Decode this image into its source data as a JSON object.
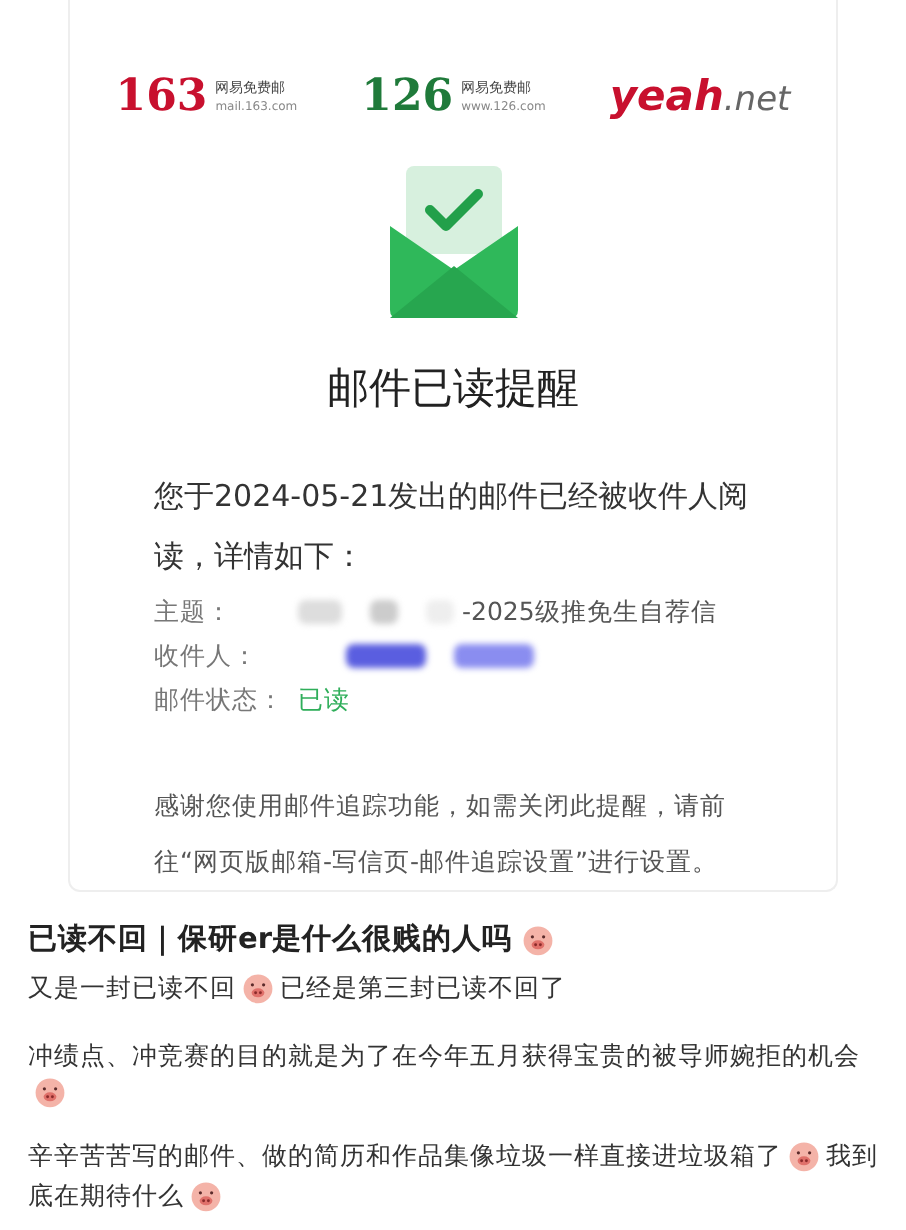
{
  "logos": [
    {
      "kind": "numeral",
      "color": "#c8102e",
      "mark": "163",
      "name": "网易免费邮",
      "url": "mail.163.com"
    },
    {
      "kind": "numeral",
      "color": "#1f7a3a",
      "mark": "126",
      "name": "网易免费邮",
      "url": "www.126.com"
    },
    {
      "kind": "wordmark",
      "color": "#c8102e",
      "mark": "yeah",
      "suffix": ".net"
    }
  ],
  "email": {
    "title": "邮件已读提醒",
    "intro": "您于2024-05-21发出的邮件已经被收件人阅读，详情如下：",
    "fields": [
      {
        "label": "主题：",
        "value": "-2025级推免生自荐信",
        "kind": "subject"
      },
      {
        "label": "收件人：",
        "kind": "recipient"
      },
      {
        "label": "邮件状态：",
        "value": "已读",
        "kind": "status"
      }
    ],
    "footer": "感谢您使用邮件追踪功能，如需关闭此提醒，请前往“网页版邮箱-写信页-邮件追踪设置”进行设置。"
  },
  "post": {
    "title": [
      {
        "kind": "text",
        "text": "已读不回｜保研er是什么很贱的人吗"
      },
      {
        "kind": "emoji"
      }
    ],
    "paragraphs": [
      [
        {
          "kind": "text",
          "text": "又是一封已读不回"
        },
        {
          "kind": "emoji"
        },
        {
          "kind": "text",
          "text": " 已经是第三封已读不回了"
        }
      ],
      [
        {
          "kind": "text",
          "text": "冲绩点、冲竞赛的目的就是为了在今年五月获得宝贵的被导师婉拒的机会"
        },
        {
          "kind": "emoji"
        }
      ],
      [
        {
          "kind": "text",
          "text": "辛辛苦苦写的邮件、做的简历和作品集像垃圾一样直接进垃圾箱了"
        },
        {
          "kind": "emoji"
        },
        {
          "kind": "text",
          "text": "我到"
        },
        {
          "kind": "text",
          "text": "底在期待什么"
        },
        {
          "kind": "emoji"
        }
      ]
    ]
  }
}
